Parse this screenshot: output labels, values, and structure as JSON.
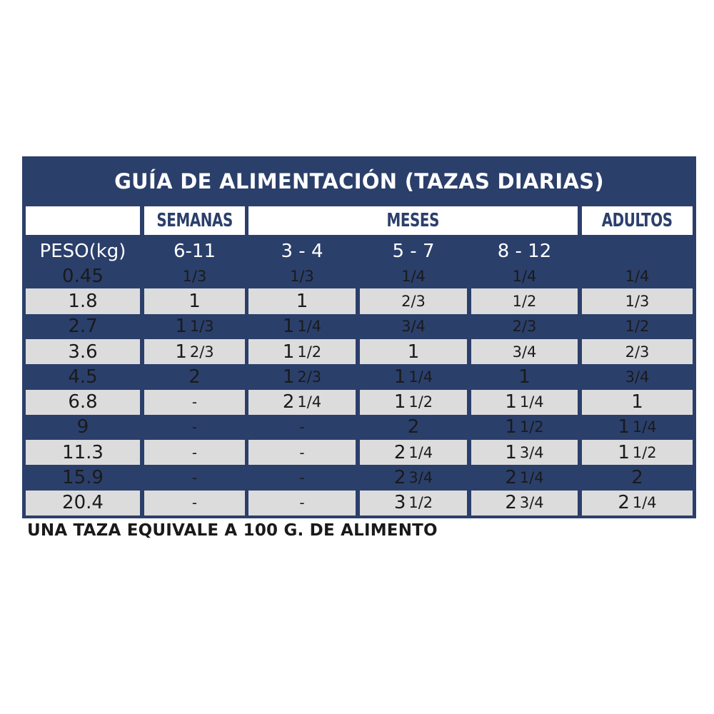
{
  "title": "GUÍA DE ALIMENTACIÓN (TAZAS DIARIAS)",
  "group_headers": {
    "semanas": "SEMANAS",
    "meses": "MESES",
    "adultos": "ADULTOS"
  },
  "sub_headers": {
    "peso": "PESO(kg)",
    "c1": "6-11",
    "c2": "3 - 4",
    "c3": "5 - 7",
    "c4": "8 - 12"
  },
  "rows": [
    [
      "0.45",
      "1/3",
      "1/3",
      "1/4",
      "1/4",
      "1/4"
    ],
    [
      "1.8",
      "1",
      "1",
      "2/3",
      "1/2",
      "1/3"
    ],
    [
      "2.7",
      "1 1/3",
      "1 1/4",
      "3/4",
      "2/3",
      "1/2"
    ],
    [
      "3.6",
      "1 2/3",
      "1 1/2",
      "1",
      "3/4",
      "2/3"
    ],
    [
      "4.5",
      "2",
      "1 2/3",
      "1 1/4",
      "1",
      "3/4"
    ],
    [
      "6.8",
      "-",
      "2 1/4",
      "1 1/2",
      "1 1/4",
      "1"
    ],
    [
      "9",
      "-",
      "-",
      "2",
      "1 1/2",
      "1 1/4"
    ],
    [
      "11.3",
      "-",
      "-",
      "2 1/4",
      "1 3/4",
      "1 1/2"
    ],
    [
      "15.9",
      "-",
      "-",
      "2 3/4",
      "2 1/4",
      "2"
    ],
    [
      "20.4",
      "-",
      "-",
      "3 1/2",
      "2 3/4",
      "2 1/4"
    ]
  ],
  "footnote": "UNA TAZA EQUIVALE A 100 G. DE ALIMENTO"
}
